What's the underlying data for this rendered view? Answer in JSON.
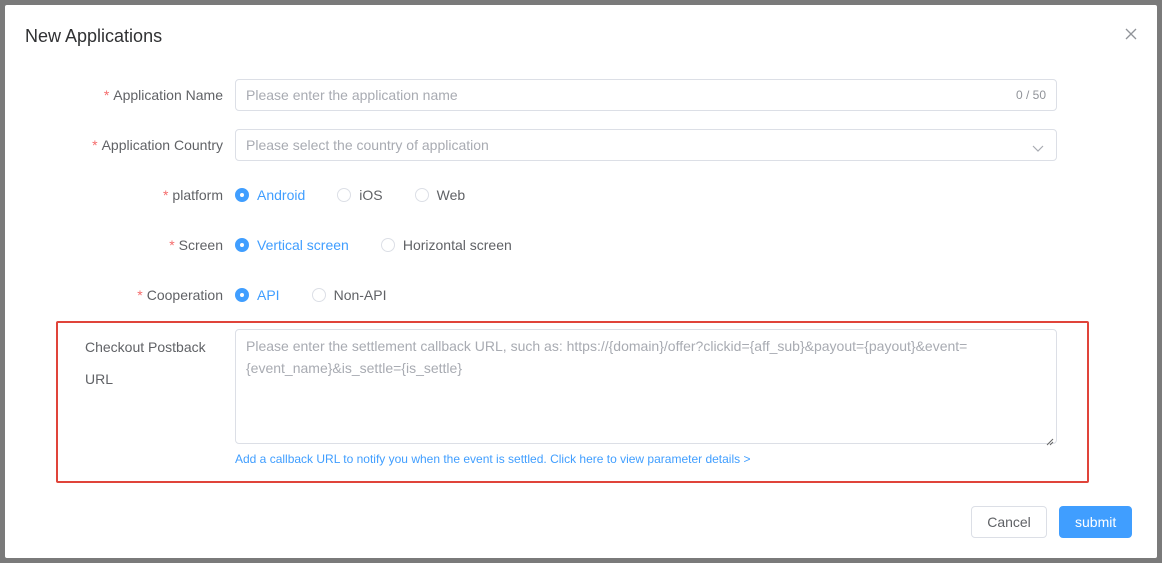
{
  "dialog": {
    "title": "New Applications",
    "close_icon": "close-icon"
  },
  "fields": {
    "app_name": {
      "label": "Application Name",
      "required_mark": "*",
      "placeholder": "Please enter the application name",
      "value": "",
      "counter": "0 / 50"
    },
    "app_country": {
      "label": "Application Country",
      "required_mark": "*",
      "placeholder": "Please select the country of application",
      "value": "",
      "arrow_icon": "chevron-down-icon"
    },
    "platform": {
      "label": "platform",
      "required_mark": "*",
      "options": [
        "Android",
        "iOS",
        "Web"
      ],
      "selected": "Android"
    },
    "screen": {
      "label": "Screen",
      "required_mark": "*",
      "options": [
        "Vertical screen",
        "Horizontal screen"
      ],
      "selected": "Vertical screen"
    },
    "cooperation": {
      "label": "Cooperation",
      "required_mark": "*",
      "options": [
        "API",
        "Non-API"
      ],
      "selected": "API"
    },
    "checkout_postback": {
      "label_line1": "Checkout Postback",
      "label_line2": "URL",
      "placeholder": "Please enter the settlement callback URL, such as: https://{domain}/offer?clickid={aff_sub}&payout={payout}&event={event_name}&is_settle={is_settle}",
      "value": "",
      "help_text": "Add a callback URL to notify you when the event is settled. Click here to view parameter details >"
    }
  },
  "footer": {
    "cancel_label": "Cancel",
    "submit_label": "submit"
  },
  "colors": {
    "primary": "#409eff",
    "required": "#f56c6c",
    "highlight_border": "#e0443a"
  }
}
